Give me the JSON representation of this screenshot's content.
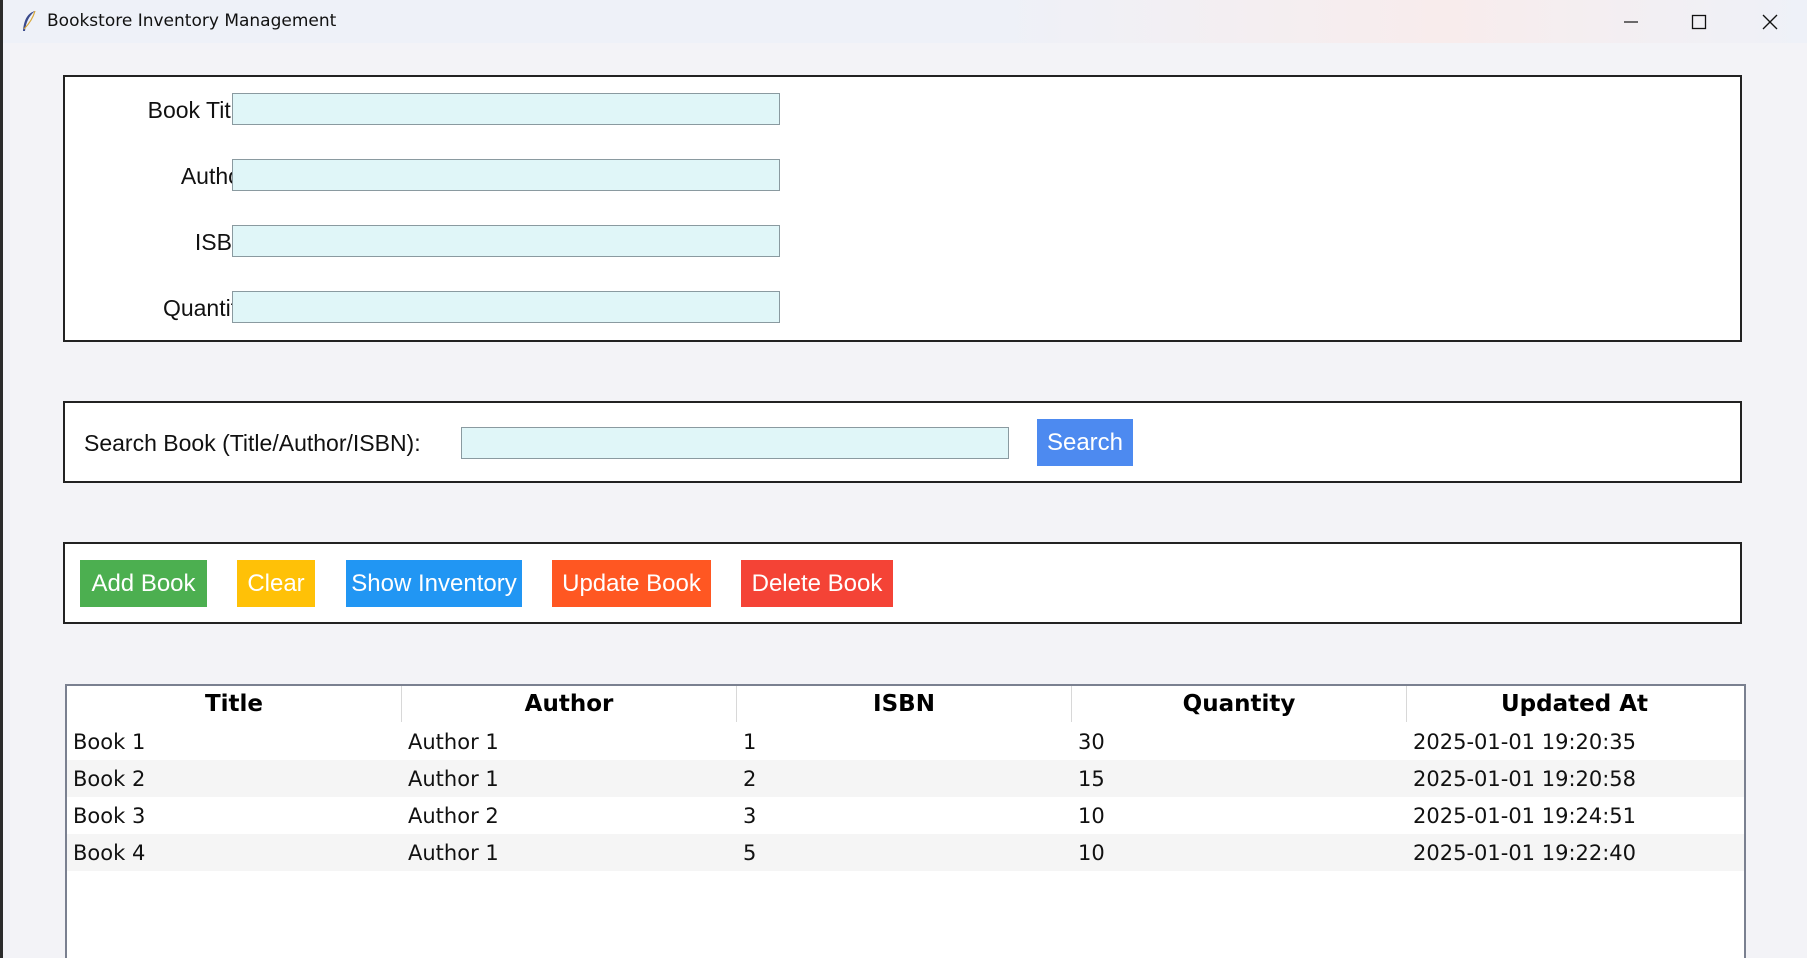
{
  "window": {
    "title": "Bookstore Inventory Management",
    "icon": "feather-icon",
    "controls": [
      "minimize-icon",
      "maximize-icon",
      "close-icon"
    ]
  },
  "form": {
    "title_label": "Book Title:",
    "title_value": "",
    "author_label": "Author:",
    "author_value": "",
    "isbn_label": "ISBN:",
    "isbn_value": "",
    "quantity_label": "Quantity:",
    "quantity_value": ""
  },
  "search": {
    "label": "Search Book (Title/Author/ISBN):",
    "value": "",
    "button_label": "Search"
  },
  "actions": {
    "add_label": "Add Book",
    "clear_label": "Clear",
    "show_label": "Show Inventory",
    "update_label": "Update Book",
    "delete_label": "Delete Book"
  },
  "colors": {
    "add": "#4caf50",
    "clear": "#ffc107",
    "show": "#2196f3",
    "update": "#ff5722",
    "delete": "#f44336",
    "search": "#4d8af0",
    "entry_bg": "#e0f6f8"
  },
  "table": {
    "columns": [
      "Title",
      "Author",
      "ISBN",
      "Quantity",
      "Updated At"
    ],
    "rows": [
      [
        "Book 1",
        "Author 1",
        "1",
        "30",
        "2025-01-01 19:20:35"
      ],
      [
        "Book 2",
        "Author 1",
        "2",
        "15",
        "2025-01-01 19:20:58"
      ],
      [
        "Book 3",
        "Author 2",
        "3",
        "10",
        "2025-01-01 19:24:51"
      ],
      [
        "Book 4",
        "Author 1",
        "5",
        "10",
        "2025-01-01 19:22:40"
      ]
    ]
  }
}
